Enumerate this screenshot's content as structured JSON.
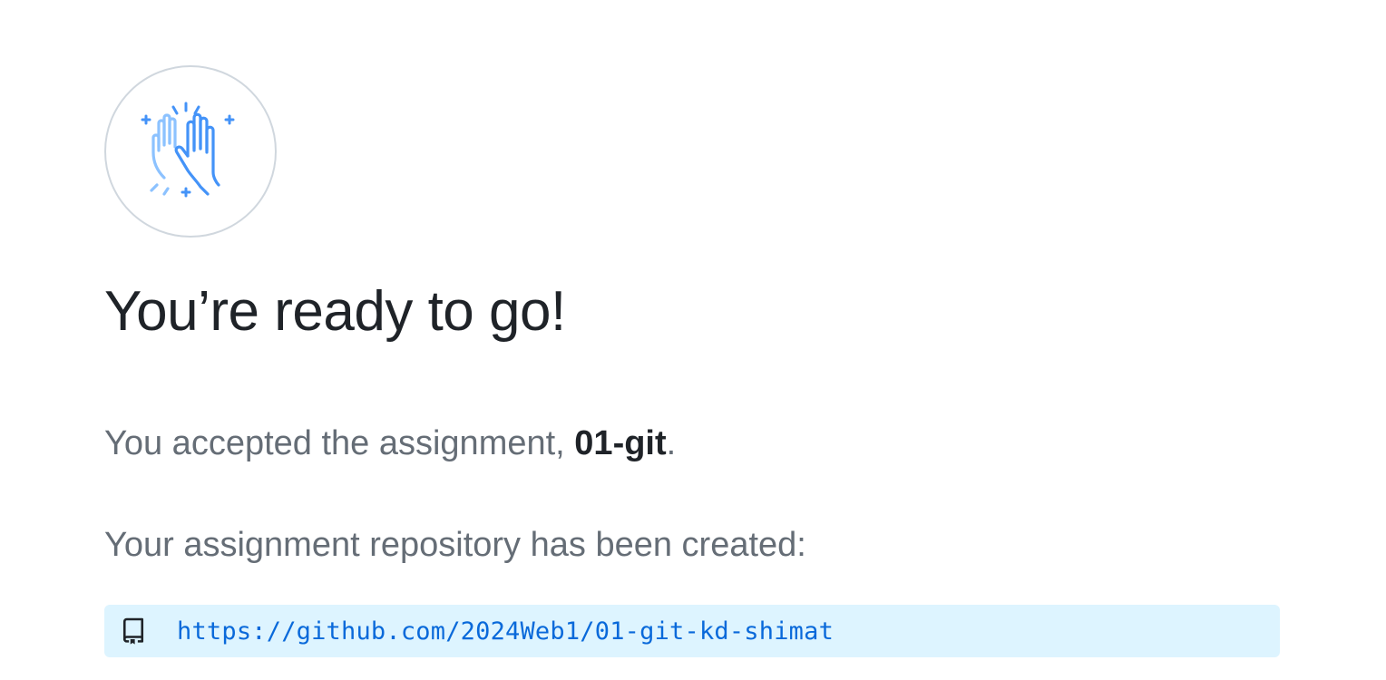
{
  "header": {
    "title": "You’re ready to go!"
  },
  "accepted": {
    "prefix": "You accepted the assignment, ",
    "assignment_name": "01-git",
    "suffix": "."
  },
  "repository": {
    "intro": "Your assignment repository has been created:",
    "url": "https://github.com/2024Web1/01-git-kd-shimat",
    "icon": "repo-icon"
  },
  "illustration": {
    "icon": "high-five-icon"
  },
  "colors": {
    "accent": "#0969da",
    "repo_bg": "#ddf4ff",
    "illustration_primary": "#4493f8",
    "illustration_secondary": "#8cc2ff",
    "muted_text": "#656d76",
    "heading_text": "#1f2328"
  }
}
